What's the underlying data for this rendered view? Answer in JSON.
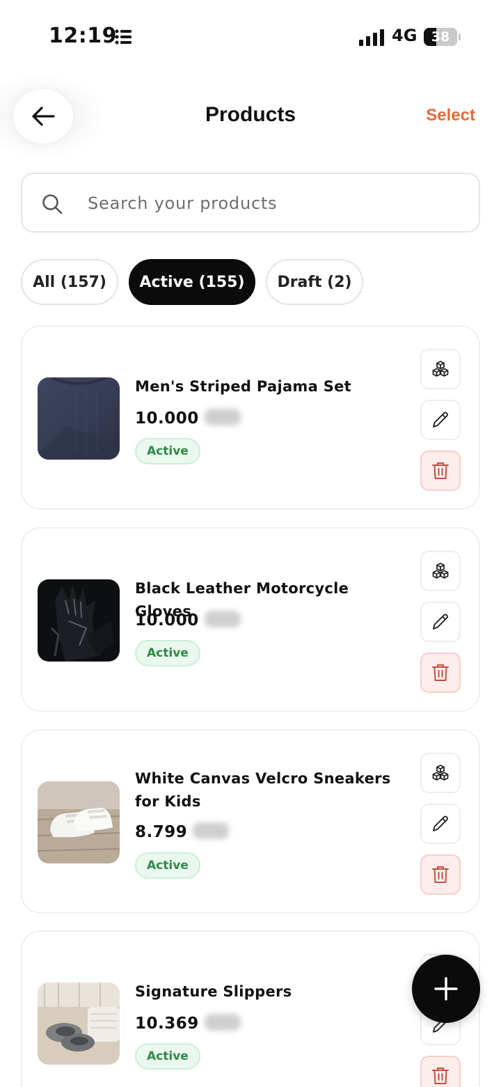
{
  "status_bar": {
    "time": "12:19",
    "network": "4G",
    "battery_level": "38",
    "battery_fraction": 0.38,
    "signal_bars": 4
  },
  "header": {
    "title": "Products",
    "select_label": "Select"
  },
  "search": {
    "placeholder": "Search your products",
    "value": ""
  },
  "tabs": [
    {
      "label": "All (157)",
      "active": false
    },
    {
      "label": "Active (155)",
      "active": true
    },
    {
      "label": "Draft (2)",
      "active": false
    }
  ],
  "products": [
    {
      "name": "Men's Striped Pajama Set",
      "price": "10.000",
      "status": "Active",
      "image": "navy-tshirt"
    },
    {
      "name": "Black Leather Motorcycle Gloves",
      "price": "10.000",
      "status": "Active",
      "image": "black-gloves"
    },
    {
      "name": "White Canvas Velcro Sneakers for Kids",
      "price": "8.799",
      "status": "Active",
      "image": "white-sneakers"
    },
    {
      "name": "Signature Slippers",
      "price": "10.369",
      "status": "Active",
      "image": "felt-slippers"
    }
  ],
  "icons": {
    "back": "arrow-left-icon",
    "search": "search-icon",
    "variants": "boxes-icon",
    "edit": "pencil-icon",
    "delete": "trash-icon",
    "add": "plus-icon"
  },
  "colors": {
    "accent": "#e46a36",
    "active_tab_bg": "#0b0b0b",
    "badge_bg": "#eaf8ee",
    "badge_text": "#2f8a47",
    "delete_bg": "#fdeeec",
    "delete_icon": "#c0503c"
  }
}
